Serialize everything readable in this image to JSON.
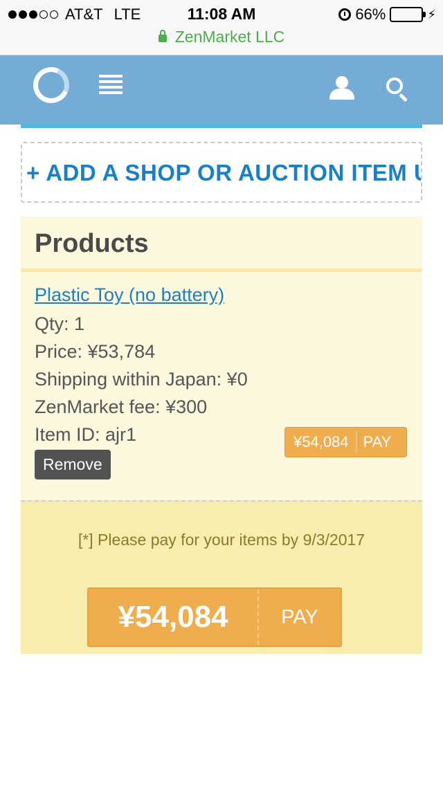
{
  "status_bar": {
    "carrier": "AT&T",
    "network": "LTE",
    "time": "11:08 AM",
    "battery": "66%",
    "battery_level": 0.66,
    "url": "ZenMarket LLC"
  },
  "header": {
    "logo": "zenmarket-logo",
    "icons": [
      "menu-icon",
      "user-icon",
      "search-icon"
    ]
  },
  "add_item": {
    "label": "+ ADD A SHOP OR AUCTION ITEM URL"
  },
  "products": {
    "title": "Products",
    "items": [
      {
        "name": "Plastic Toy (no battery)",
        "qty": "Qty: 1",
        "price": "Price: ¥53,784",
        "shipping": "Shipping within Japan: ¥0",
        "fee": "ZenMarket fee: ¥300",
        "item_id": "Item ID: ajr1",
        "remove_label": "Remove",
        "pay_amount": "¥54,084",
        "pay_label": "PAY"
      }
    ]
  },
  "checkout": {
    "deadline": "[*] Please pay for your items by 9/3/2017",
    "total": "¥54,084",
    "pay_label": "PAY"
  },
  "colors": {
    "header_bg": "#75acd5",
    "link": "#1a7fc4",
    "pay_button": "#f0ad4e",
    "panel_bg": "#fcf8dd",
    "pay_area_bg": "#f6edaf"
  }
}
